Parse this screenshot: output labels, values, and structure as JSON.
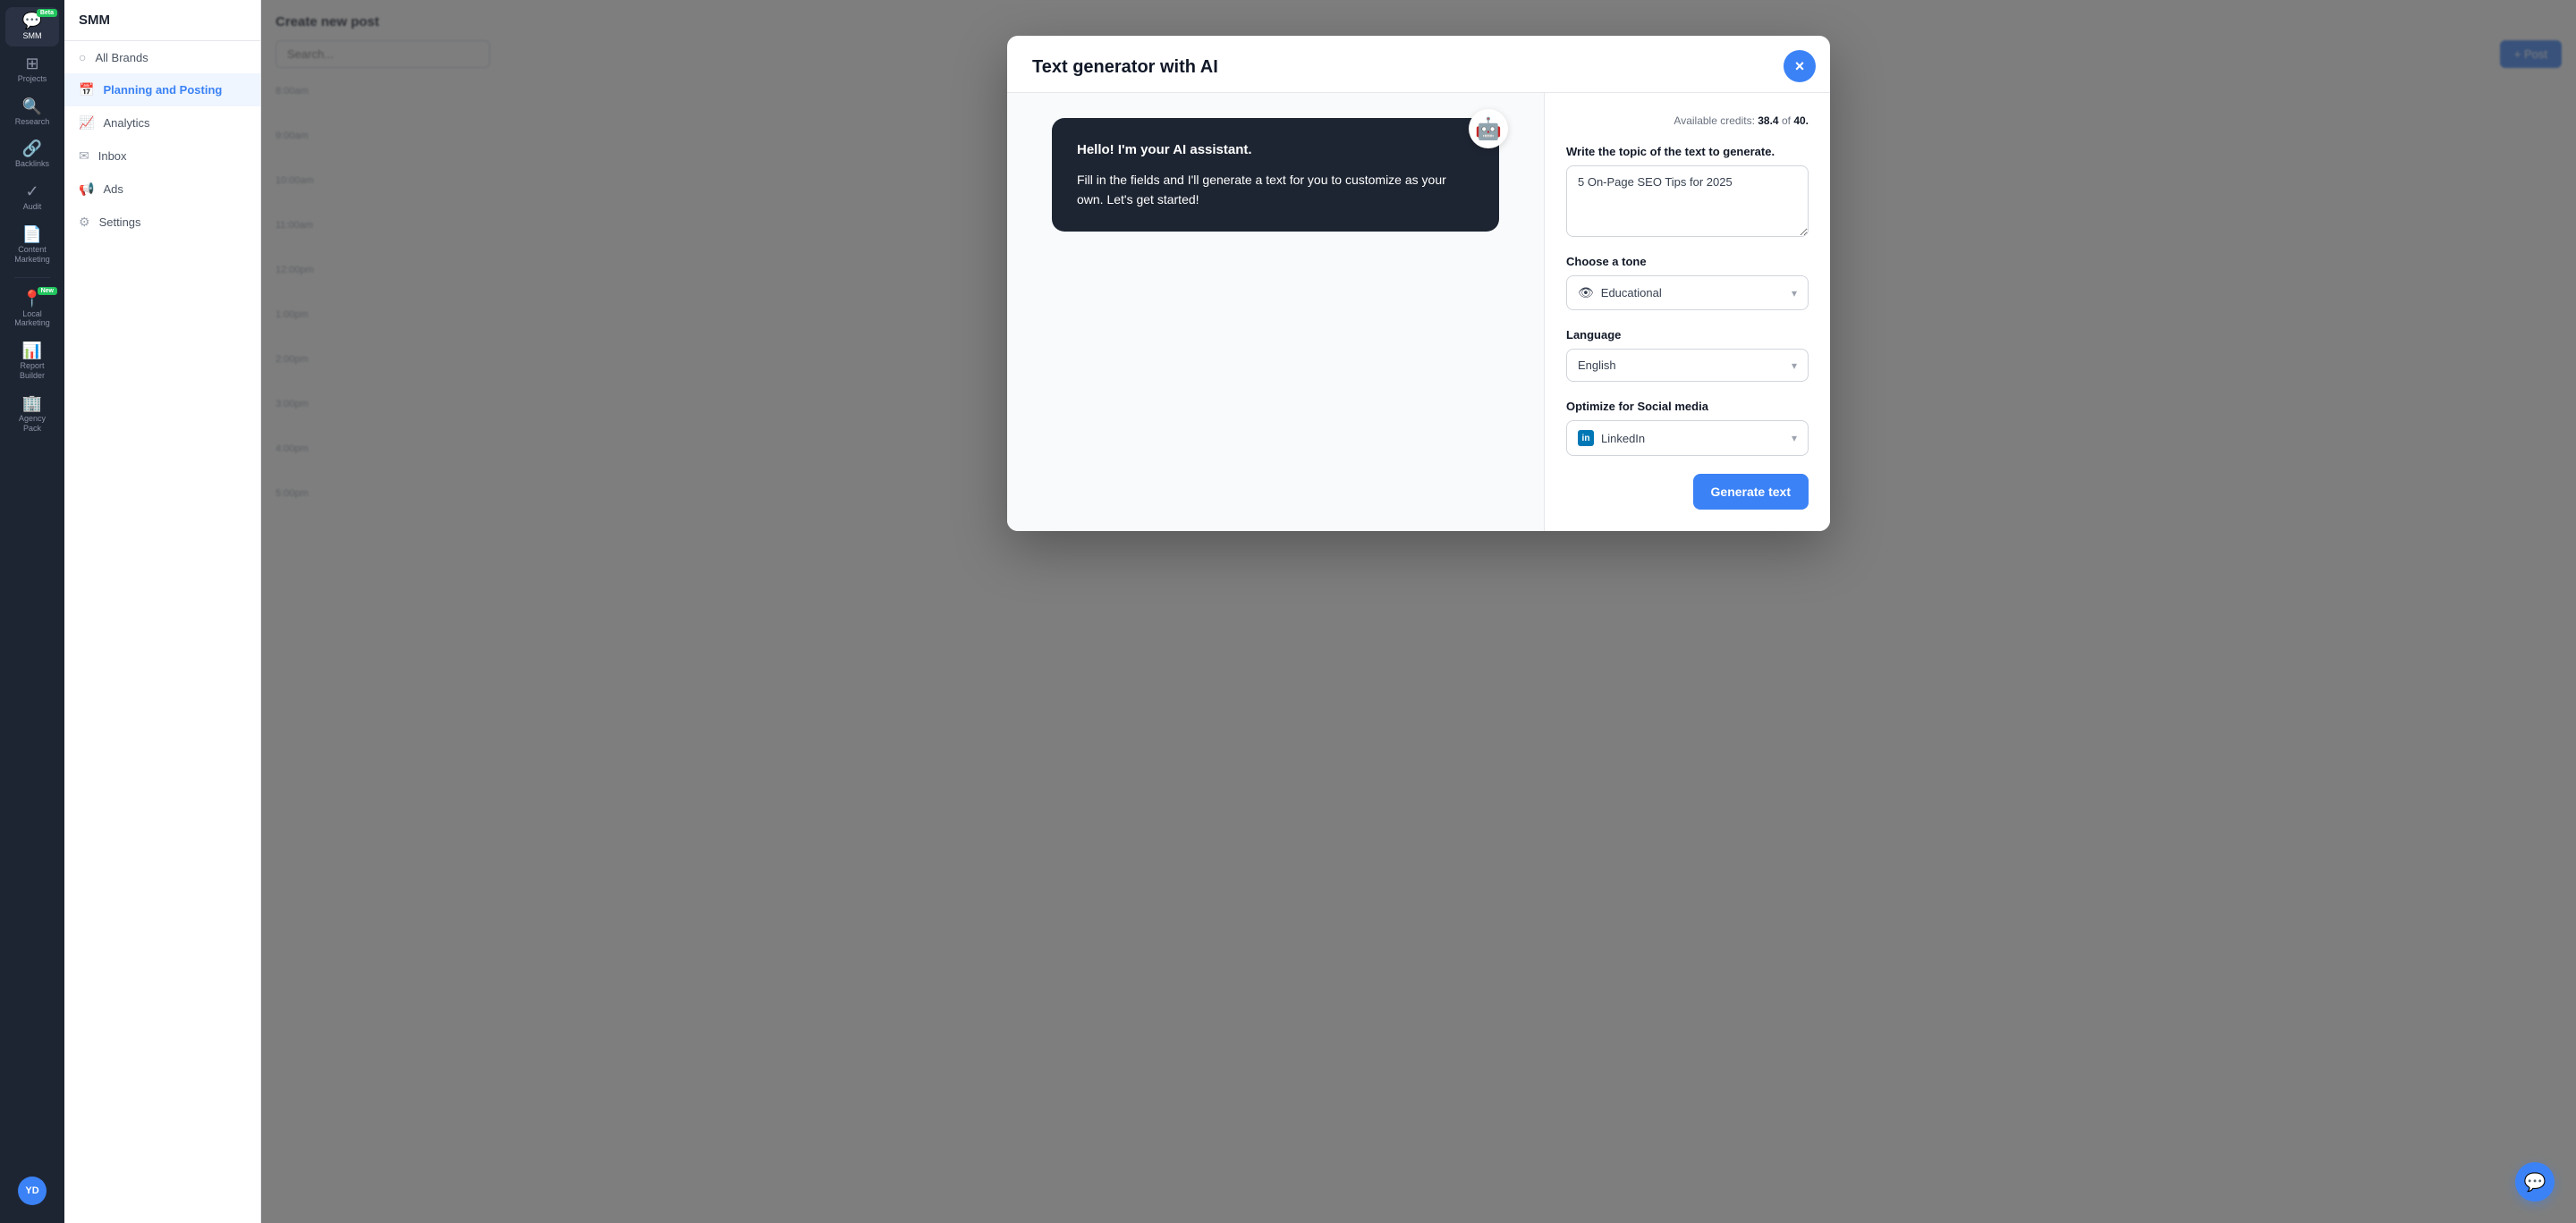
{
  "app": {
    "title": "SMM"
  },
  "sidebar": {
    "items": [
      {
        "id": "projects",
        "label": "Projects",
        "icon": "⊞",
        "active": false
      },
      {
        "id": "research",
        "label": "Research",
        "icon": "🔍",
        "active": false
      },
      {
        "id": "backlinks",
        "label": "Backlinks",
        "icon": "🔗",
        "active": false
      },
      {
        "id": "audit",
        "label": "Audit",
        "icon": "✓",
        "active": false
      },
      {
        "id": "content-marketing",
        "label": "Content Marketing",
        "icon": "📄",
        "active": false
      },
      {
        "id": "smm",
        "label": "SMM",
        "icon": "💬",
        "active": true,
        "badge": "Beta"
      },
      {
        "id": "local-marketing",
        "label": "Local Marketing",
        "icon": "📍",
        "active": false,
        "badge": "New"
      },
      {
        "id": "report-builder",
        "label": "Report Builder",
        "icon": "📊",
        "active": false
      },
      {
        "id": "agency-pack",
        "label": "Agency Pack",
        "icon": "🏢",
        "active": false
      }
    ],
    "avatar": {
      "initials": "YD"
    }
  },
  "nav_panel": {
    "header": "SMM",
    "items": [
      {
        "id": "all-brands",
        "label": "All Brands",
        "icon": "○",
        "active": false
      },
      {
        "id": "planning-posting",
        "label": "Planning and Posting",
        "icon": "📅",
        "active": true
      },
      {
        "id": "analytics",
        "label": "Analytics",
        "icon": "📈",
        "active": false
      },
      {
        "id": "inbox",
        "label": "Inbox",
        "icon": "✉",
        "active": false
      },
      {
        "id": "ads",
        "label": "Ads",
        "icon": "📢",
        "active": false
      },
      {
        "id": "settings",
        "label": "Settings",
        "icon": "⚙",
        "active": false
      }
    ]
  },
  "calendar": {
    "create_title": "Create new post",
    "search_placeholder": "Search...",
    "times": [
      "8:00am",
      "9:00am",
      "10:00am",
      "11:00am",
      "12:00pm",
      "1:00pm",
      "2:00pm",
      "3:00pm",
      "4:00pm",
      "5:00pm"
    ]
  },
  "modal": {
    "title": "Text generator with AI",
    "close_label": "×",
    "credits": {
      "prefix": "Available credits:",
      "current": "38.4",
      "separator": "of",
      "total": "40."
    },
    "ai_avatar": "🤖",
    "chat": {
      "greeting": "Hello! I'm your AI assistant.",
      "body": "Fill in the fields and I'll generate a text for you to customize as your own. Let's get started!"
    },
    "form": {
      "topic_label": "Write the topic of the text to generate.",
      "topic_value": "5 On-Page SEO Tips for 2025",
      "tone_label": "Choose a tone",
      "tone_value": "Educational",
      "tone_icon": "👁",
      "language_label": "Language",
      "language_value": "English",
      "social_label": "Optimize for Social media",
      "social_value": "LinkedIn",
      "social_icon": "in",
      "generate_button": "Generate text"
    }
  },
  "chat_fab": {
    "icon": "💬"
  }
}
